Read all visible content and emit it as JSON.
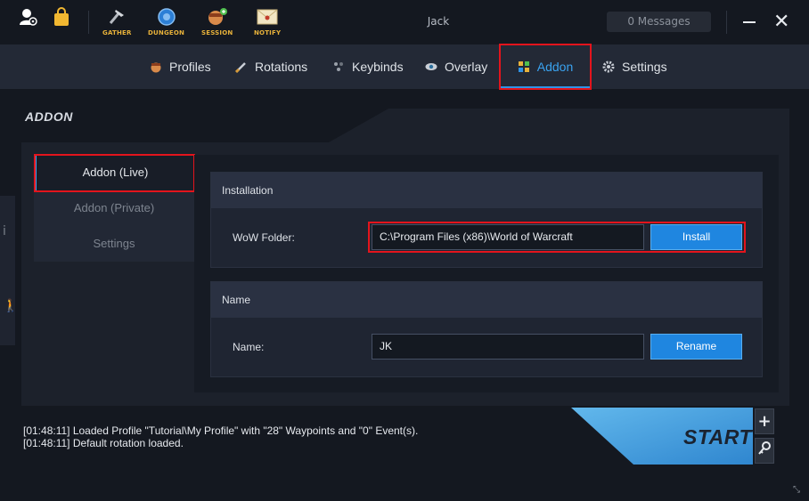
{
  "titlebar": {
    "buttons": [
      {
        "name": "account-icon",
        "label": ""
      },
      {
        "name": "store-icon",
        "label": ""
      },
      {
        "name": "gather-icon",
        "label": "GATHER"
      },
      {
        "name": "dungeon-icon",
        "label": "DUNGEON"
      },
      {
        "name": "session-icon",
        "label": "SESSION"
      },
      {
        "name": "notify-icon",
        "label": "NOTIFY"
      }
    ],
    "user": "Jack",
    "messages": "0 Messages"
  },
  "tabs": [
    {
      "label": "Profiles",
      "icon": "profile-icon"
    },
    {
      "label": "Rotations",
      "icon": "sword-icon"
    },
    {
      "label": "Keybinds",
      "icon": "keybind-icon"
    },
    {
      "label": "Overlay",
      "icon": "eye-icon"
    },
    {
      "label": "Addon",
      "icon": "addon-icon",
      "active": true
    },
    {
      "label": "Settings",
      "icon": "gear-icon"
    }
  ],
  "section_title": "ADDON",
  "side_tabs": [
    "info-icon",
    "walk-icon"
  ],
  "subnav": {
    "items": [
      "Addon (Live)",
      "Addon (Private)",
      "Settings"
    ],
    "active": "Addon (Live)"
  },
  "installation": {
    "header": "Installation",
    "label": "WoW Folder:",
    "value": "C:\\Program Files (x86)\\World of Warcraft",
    "button": "Install"
  },
  "name_card": {
    "header": "Name",
    "label": "Name:",
    "value": "JK",
    "button": "Rename"
  },
  "log": [
    "[01:48:11] Loaded Profile \"Tutorial\\My Profile\" with \"28\" Waypoints and \"0\" Event(s).",
    "[01:48:11] Default rotation loaded."
  ],
  "start_label": "START",
  "colors": {
    "accent": "#2f93e6",
    "highlight_box": "#e3141c",
    "background": "#141820"
  }
}
